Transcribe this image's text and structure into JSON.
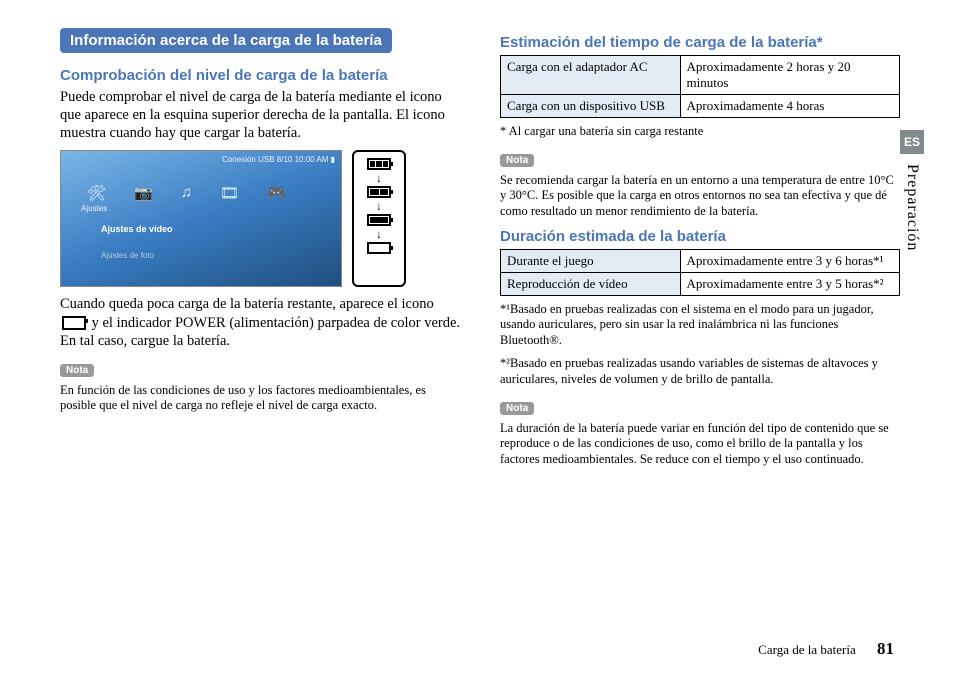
{
  "banner": "Información acerca de la carga de la batería",
  "left": {
    "h1": "Comprobación del nivel de carga de la batería",
    "p1": "Puede comprobar el nivel de carga de la batería mediante el icono que aparece en la esquina superior derecha de la pantalla. El icono muestra cuando hay que cargar la batería.",
    "psp": {
      "status": "Conexión USB        8/10 10:00 AM  ▮",
      "ajustes": "Ajustes",
      "item1": "Ajustes de vídeo",
      "item2": "Ajustes de foto",
      "topicons": [
        "🛠",
        "📷",
        "♫",
        "🎞",
        "🎮"
      ]
    },
    "p2a": "Cuando queda poca carga de la batería restante, aparece el icono ",
    "p2b": " y el indicador POWER (alimentación) parpadea de color verde. En tal caso, cargue la batería.",
    "nota": "Nota",
    "note1": "En función de las condiciones de uso y los factores medioambientales, es posible que el nivel de carga no refleje el nivel de carga exacto."
  },
  "right": {
    "h2": "Estimación del tiempo de carga de la batería*",
    "table1": [
      [
        "Carga con el adaptador AC",
        "Aproximadamente 2 horas y 20 minutos"
      ],
      [
        "Carga con un dispositivo USB",
        "Aproximadamente 4 horas"
      ]
    ],
    "starline": "* Al cargar una batería sin carga restante",
    "nota": "Nota",
    "note2": "Se recomienda cargar la batería en un entorno a una temperatura de entre 10°C y 30°C. Es posible que la carga en otros entornos no sea tan efectiva y que dé como resultado un menor rendimiento de la batería.",
    "h3": "Duración estimada de la batería",
    "table2": [
      [
        "Durante el juego",
        "Aproximadamente entre 3 y 6 horas*¹"
      ],
      [
        "Reproducción de vídeo",
        "Aproximadamente entre 3 y 5 horas*²"
      ]
    ],
    "fn1": "*¹Basado en pruebas realizadas con el sistema en el modo para un jugador, usando auriculares, pero sin usar la red inalámbrica ni las funciones Bluetooth®.",
    "fn2": "*²Basado en pruebas realizadas usando variables de sistemas de altavoces y auriculares, niveles de volumen y de brillo de pantalla.",
    "note3": "La duración de la batería puede variar en función del tipo de contenido que se reproduce o de las condiciones de uso, como el brillo de la pantalla y los factores medioambientales. Se reduce con el tiempo y el uso continuado."
  },
  "side": {
    "flag": "ES",
    "section": "Preparación"
  },
  "footer": {
    "title": "Carga de la batería",
    "page": "81"
  }
}
